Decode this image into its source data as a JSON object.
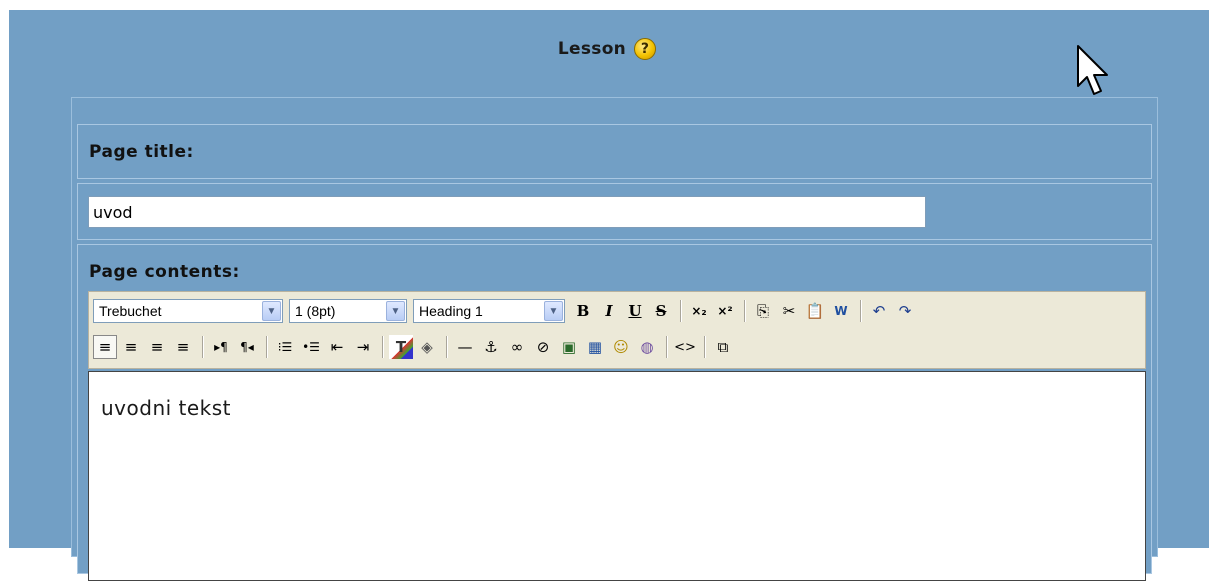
{
  "header": {
    "title": "Lesson",
    "help_icon": "help-icon"
  },
  "form": {
    "page_title_label": "Page title:",
    "page_title_value": "uvod",
    "page_contents_label": "Page contents:"
  },
  "toolbar": {
    "font_family": "Trebuchet",
    "font_size": "1 (8pt)",
    "format_block": "Heading 1",
    "bold": "B",
    "italic": "I",
    "underline": "U",
    "strikethrough": "S",
    "subscript": "×₂",
    "superscript": "×²",
    "copy": "⎘",
    "cut": "✂",
    "paste": "📋",
    "paste_word": "W",
    "undo": "↶",
    "redo": "↷",
    "justify_left": "≡",
    "justify_center": "≡",
    "justify_right": "≡",
    "justify_full": "≡",
    "ltr": "▸¶",
    "rtl": "¶◂",
    "ordered_list": "⁝☰",
    "unordered_list": "•☰",
    "outdent": "⇤",
    "indent": "⇥",
    "text_color": "T",
    "bg_color": "◈",
    "horizontal_rule": "—",
    "anchor": "⚓",
    "link": "∞",
    "unlink": "⊘",
    "image": "▣",
    "table": "▦",
    "smiley": "☺",
    "special_char": "◍",
    "html_source": "<>",
    "fullscreen": "⧉"
  },
  "editor": {
    "content": "uvodni tekst"
  }
}
